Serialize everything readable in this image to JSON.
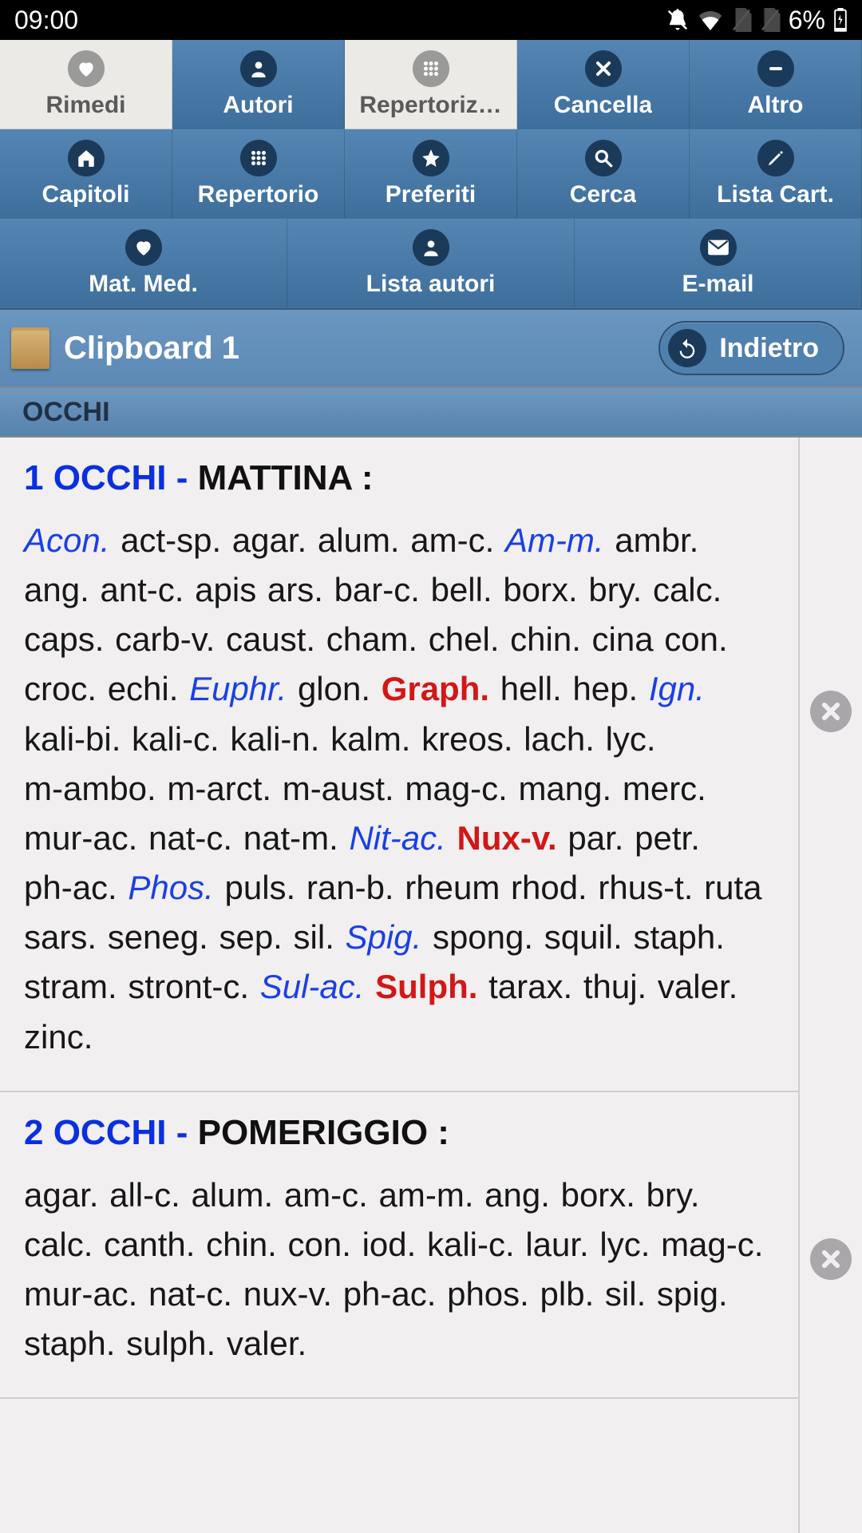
{
  "status": {
    "time": "09:00",
    "battery_text": "6%"
  },
  "toolbar": {
    "row1": [
      {
        "name": "rimedi",
        "label": "Rimedi",
        "icon": "heart",
        "selected": true
      },
      {
        "name": "autori",
        "label": "Autori",
        "icon": "person",
        "selected": false
      },
      {
        "name": "repertoriz",
        "label": "Repertoriz…",
        "icon": "grid",
        "selected": true
      },
      {
        "name": "cancella",
        "label": "Cancella",
        "icon": "close",
        "selected": false
      },
      {
        "name": "altro",
        "label": "Altro",
        "icon": "minus",
        "selected": false
      }
    ],
    "row1_spacer": true,
    "row2": [
      {
        "name": "capitoli",
        "label": "Capitoli",
        "icon": "home"
      },
      {
        "name": "repertorio",
        "label": "Repertorio",
        "icon": "grid"
      },
      {
        "name": "preferiti",
        "label": "Preferiti",
        "icon": "star"
      },
      {
        "name": "cerca",
        "label": "Cerca",
        "icon": "search"
      },
      {
        "name": "lista-cart",
        "label": "Lista Cart.",
        "icon": "pencil"
      }
    ],
    "row3": [
      {
        "name": "mat-med",
        "label": "Mat. Med.",
        "icon": "heart"
      },
      {
        "name": "lista-autori",
        "label": "Lista autori",
        "icon": "person"
      },
      {
        "name": "email",
        "label": "E-mail",
        "icon": "mail"
      }
    ]
  },
  "clipboard": {
    "title": "Clipboard 1",
    "back_label": "Indietro"
  },
  "section": {
    "header": "OCCHI"
  },
  "entries": [
    {
      "index": "1",
      "chapter": "OCCHI",
      "rubric": "MATTINA :",
      "remedies": [
        {
          "t": "Acon.",
          "s": "blue"
        },
        {
          "t": "act-sp."
        },
        {
          "t": "agar."
        },
        {
          "t": "alum."
        },
        {
          "t": "am-c."
        },
        {
          "t": "Am-m.",
          "s": "blue"
        },
        {
          "t": "ambr."
        },
        {
          "t": "ang."
        },
        {
          "t": "ant-c."
        },
        {
          "t": "apis"
        },
        {
          "t": "ars."
        },
        {
          "t": "bar-c."
        },
        {
          "t": "bell."
        },
        {
          "t": "borx."
        },
        {
          "t": "bry."
        },
        {
          "t": "calc."
        },
        {
          "t": "caps."
        },
        {
          "t": "carb-v."
        },
        {
          "t": "caust."
        },
        {
          "t": "cham."
        },
        {
          "t": "chel."
        },
        {
          "t": "chin."
        },
        {
          "t": "cina"
        },
        {
          "t": "con."
        },
        {
          "t": "croc."
        },
        {
          "t": "echi."
        },
        {
          "t": "Euphr.",
          "s": "blue"
        },
        {
          "t": "glon."
        },
        {
          "t": "Graph.",
          "s": "red"
        },
        {
          "t": "hell."
        },
        {
          "t": "hep."
        },
        {
          "t": "Ign.",
          "s": "blue"
        },
        {
          "t": "kali-bi."
        },
        {
          "t": "kali-c."
        },
        {
          "t": "kali-n."
        },
        {
          "t": "kalm."
        },
        {
          "t": "kreos."
        },
        {
          "t": "lach."
        },
        {
          "t": "lyc."
        },
        {
          "t": "m-ambo."
        },
        {
          "t": "m-arct."
        },
        {
          "t": "m-aust."
        },
        {
          "t": "mag-c."
        },
        {
          "t": "mang."
        },
        {
          "t": "merc."
        },
        {
          "t": "mur-ac."
        },
        {
          "t": "nat-c."
        },
        {
          "t": "nat-m."
        },
        {
          "t": "Nit-ac.",
          "s": "blue"
        },
        {
          "t": "Nux-v.",
          "s": "red"
        },
        {
          "t": "par."
        },
        {
          "t": "petr."
        },
        {
          "t": "ph-ac."
        },
        {
          "t": "Phos.",
          "s": "blue"
        },
        {
          "t": "puls."
        },
        {
          "t": "ran-b."
        },
        {
          "t": "rheum"
        },
        {
          "t": "rhod."
        },
        {
          "t": "rhus-t."
        },
        {
          "t": "ruta"
        },
        {
          "t": "sars."
        },
        {
          "t": "seneg."
        },
        {
          "t": "sep."
        },
        {
          "t": "sil."
        },
        {
          "t": "Spig.",
          "s": "blue"
        },
        {
          "t": "spong."
        },
        {
          "t": "squil."
        },
        {
          "t": "staph."
        },
        {
          "t": "stram."
        },
        {
          "t": "stront-c."
        },
        {
          "t": "Sul-ac.",
          "s": "blue"
        },
        {
          "t": "Sulph.",
          "s": "red"
        },
        {
          "t": "tarax."
        },
        {
          "t": "thuj."
        },
        {
          "t": "valer."
        },
        {
          "t": "zinc."
        }
      ]
    },
    {
      "index": "2",
      "chapter": "OCCHI",
      "rubric": "POMERIGGIO :",
      "remedies": [
        {
          "t": "agar."
        },
        {
          "t": "all-c."
        },
        {
          "t": "alum."
        },
        {
          "t": "am-c."
        },
        {
          "t": "am-m."
        },
        {
          "t": "ang."
        },
        {
          "t": "borx."
        },
        {
          "t": "bry."
        },
        {
          "t": "calc."
        },
        {
          "t": "canth."
        },
        {
          "t": "chin."
        },
        {
          "t": "con."
        },
        {
          "t": "iod."
        },
        {
          "t": "kali-c."
        },
        {
          "t": "laur."
        },
        {
          "t": "lyc."
        },
        {
          "t": "mag-c."
        },
        {
          "t": "mur-ac."
        },
        {
          "t": "nat-c."
        },
        {
          "t": "nux-v."
        },
        {
          "t": "ph-ac."
        },
        {
          "t": "phos."
        },
        {
          "t": "plb."
        },
        {
          "t": "sil."
        },
        {
          "t": "spig."
        },
        {
          "t": "staph."
        },
        {
          "t": "sulph."
        },
        {
          "t": "valer."
        }
      ]
    }
  ]
}
